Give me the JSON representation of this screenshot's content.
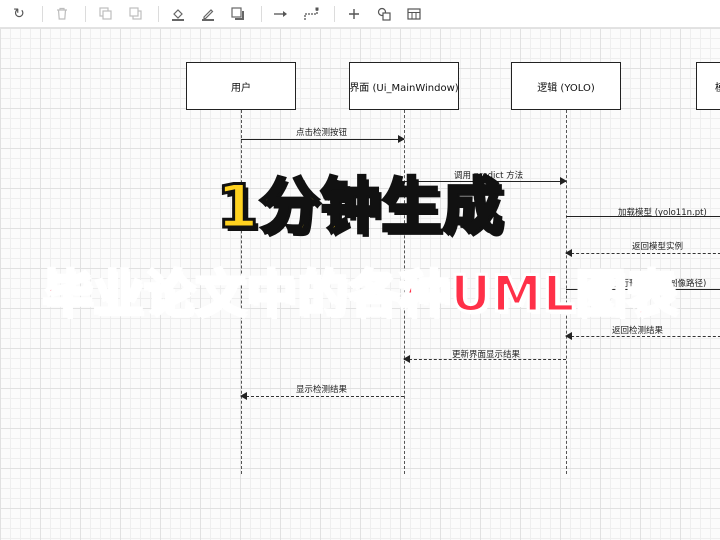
{
  "toolbar": {
    "icons": [
      "redo-icon",
      "trash-icon",
      "to-front-icon",
      "to-back-icon",
      "fill-color-icon",
      "line-color-icon",
      "shadow-icon",
      "connection-icon",
      "waypoints-icon",
      "insert-icon",
      "shapes-icon",
      "table-icon"
    ]
  },
  "diagram": {
    "participants": [
      "用户",
      "界面 (Ui_MainWindow)",
      "逻辑 (YOLO)",
      "模"
    ],
    "messages": [
      "点击检测按钮",
      "调用 predict 方法",
      "加载模型 (yolo11n.pt)",
      "返回模型实例",
      "执行预测 (输入图像路径)",
      "返回检测结果",
      "更新界面显示结果",
      "显示检测结果"
    ]
  },
  "overlay": {
    "title_line1": "1分钟生成",
    "title_line2": "毕业论文中的各种UML图表"
  },
  "colors": {
    "title1": "#FFD21F",
    "title2": "#FF3048"
  }
}
